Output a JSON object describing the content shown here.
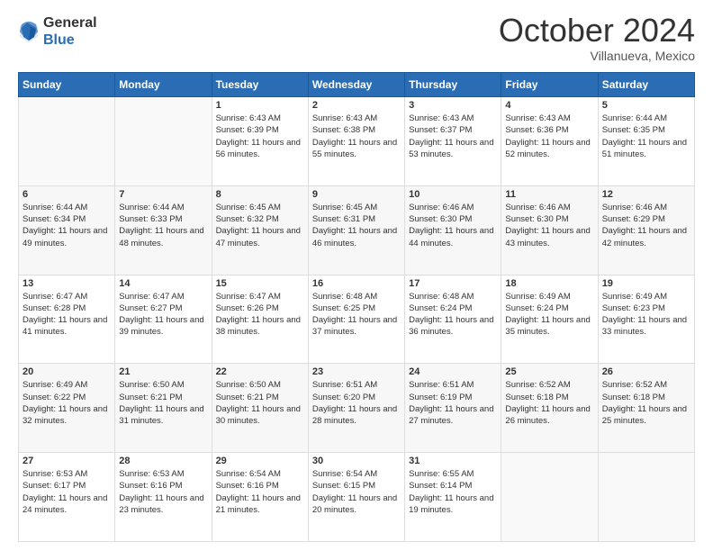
{
  "header": {
    "logo": {
      "line1": "General",
      "line2": "Blue"
    },
    "title": "October 2024",
    "location": "Villanueva, Mexico"
  },
  "weekdays": [
    "Sunday",
    "Monday",
    "Tuesday",
    "Wednesday",
    "Thursday",
    "Friday",
    "Saturday"
  ],
  "weeks": [
    [
      {
        "day": "",
        "info": ""
      },
      {
        "day": "",
        "info": ""
      },
      {
        "day": "1",
        "info": "Sunrise: 6:43 AM\nSunset: 6:39 PM\nDaylight: 11 hours and 56 minutes."
      },
      {
        "day": "2",
        "info": "Sunrise: 6:43 AM\nSunset: 6:38 PM\nDaylight: 11 hours and 55 minutes."
      },
      {
        "day": "3",
        "info": "Sunrise: 6:43 AM\nSunset: 6:37 PM\nDaylight: 11 hours and 53 minutes."
      },
      {
        "day": "4",
        "info": "Sunrise: 6:43 AM\nSunset: 6:36 PM\nDaylight: 11 hours and 52 minutes."
      },
      {
        "day": "5",
        "info": "Sunrise: 6:44 AM\nSunset: 6:35 PM\nDaylight: 11 hours and 51 minutes."
      }
    ],
    [
      {
        "day": "6",
        "info": "Sunrise: 6:44 AM\nSunset: 6:34 PM\nDaylight: 11 hours and 49 minutes."
      },
      {
        "day": "7",
        "info": "Sunrise: 6:44 AM\nSunset: 6:33 PM\nDaylight: 11 hours and 48 minutes."
      },
      {
        "day": "8",
        "info": "Sunrise: 6:45 AM\nSunset: 6:32 PM\nDaylight: 11 hours and 47 minutes."
      },
      {
        "day": "9",
        "info": "Sunrise: 6:45 AM\nSunset: 6:31 PM\nDaylight: 11 hours and 46 minutes."
      },
      {
        "day": "10",
        "info": "Sunrise: 6:46 AM\nSunset: 6:30 PM\nDaylight: 11 hours and 44 minutes."
      },
      {
        "day": "11",
        "info": "Sunrise: 6:46 AM\nSunset: 6:30 PM\nDaylight: 11 hours and 43 minutes."
      },
      {
        "day": "12",
        "info": "Sunrise: 6:46 AM\nSunset: 6:29 PM\nDaylight: 11 hours and 42 minutes."
      }
    ],
    [
      {
        "day": "13",
        "info": "Sunrise: 6:47 AM\nSunset: 6:28 PM\nDaylight: 11 hours and 41 minutes."
      },
      {
        "day": "14",
        "info": "Sunrise: 6:47 AM\nSunset: 6:27 PM\nDaylight: 11 hours and 39 minutes."
      },
      {
        "day": "15",
        "info": "Sunrise: 6:47 AM\nSunset: 6:26 PM\nDaylight: 11 hours and 38 minutes."
      },
      {
        "day": "16",
        "info": "Sunrise: 6:48 AM\nSunset: 6:25 PM\nDaylight: 11 hours and 37 minutes."
      },
      {
        "day": "17",
        "info": "Sunrise: 6:48 AM\nSunset: 6:24 PM\nDaylight: 11 hours and 36 minutes."
      },
      {
        "day": "18",
        "info": "Sunrise: 6:49 AM\nSunset: 6:24 PM\nDaylight: 11 hours and 35 minutes."
      },
      {
        "day": "19",
        "info": "Sunrise: 6:49 AM\nSunset: 6:23 PM\nDaylight: 11 hours and 33 minutes."
      }
    ],
    [
      {
        "day": "20",
        "info": "Sunrise: 6:49 AM\nSunset: 6:22 PM\nDaylight: 11 hours and 32 minutes."
      },
      {
        "day": "21",
        "info": "Sunrise: 6:50 AM\nSunset: 6:21 PM\nDaylight: 11 hours and 31 minutes."
      },
      {
        "day": "22",
        "info": "Sunrise: 6:50 AM\nSunset: 6:21 PM\nDaylight: 11 hours and 30 minutes."
      },
      {
        "day": "23",
        "info": "Sunrise: 6:51 AM\nSunset: 6:20 PM\nDaylight: 11 hours and 28 minutes."
      },
      {
        "day": "24",
        "info": "Sunrise: 6:51 AM\nSunset: 6:19 PM\nDaylight: 11 hours and 27 minutes."
      },
      {
        "day": "25",
        "info": "Sunrise: 6:52 AM\nSunset: 6:18 PM\nDaylight: 11 hours and 26 minutes."
      },
      {
        "day": "26",
        "info": "Sunrise: 6:52 AM\nSunset: 6:18 PM\nDaylight: 11 hours and 25 minutes."
      }
    ],
    [
      {
        "day": "27",
        "info": "Sunrise: 6:53 AM\nSunset: 6:17 PM\nDaylight: 11 hours and 24 minutes."
      },
      {
        "day": "28",
        "info": "Sunrise: 6:53 AM\nSunset: 6:16 PM\nDaylight: 11 hours and 23 minutes."
      },
      {
        "day": "29",
        "info": "Sunrise: 6:54 AM\nSunset: 6:16 PM\nDaylight: 11 hours and 21 minutes."
      },
      {
        "day": "30",
        "info": "Sunrise: 6:54 AM\nSunset: 6:15 PM\nDaylight: 11 hours and 20 minutes."
      },
      {
        "day": "31",
        "info": "Sunrise: 6:55 AM\nSunset: 6:14 PM\nDaylight: 11 hours and 19 minutes."
      },
      {
        "day": "",
        "info": ""
      },
      {
        "day": "",
        "info": ""
      }
    ]
  ]
}
